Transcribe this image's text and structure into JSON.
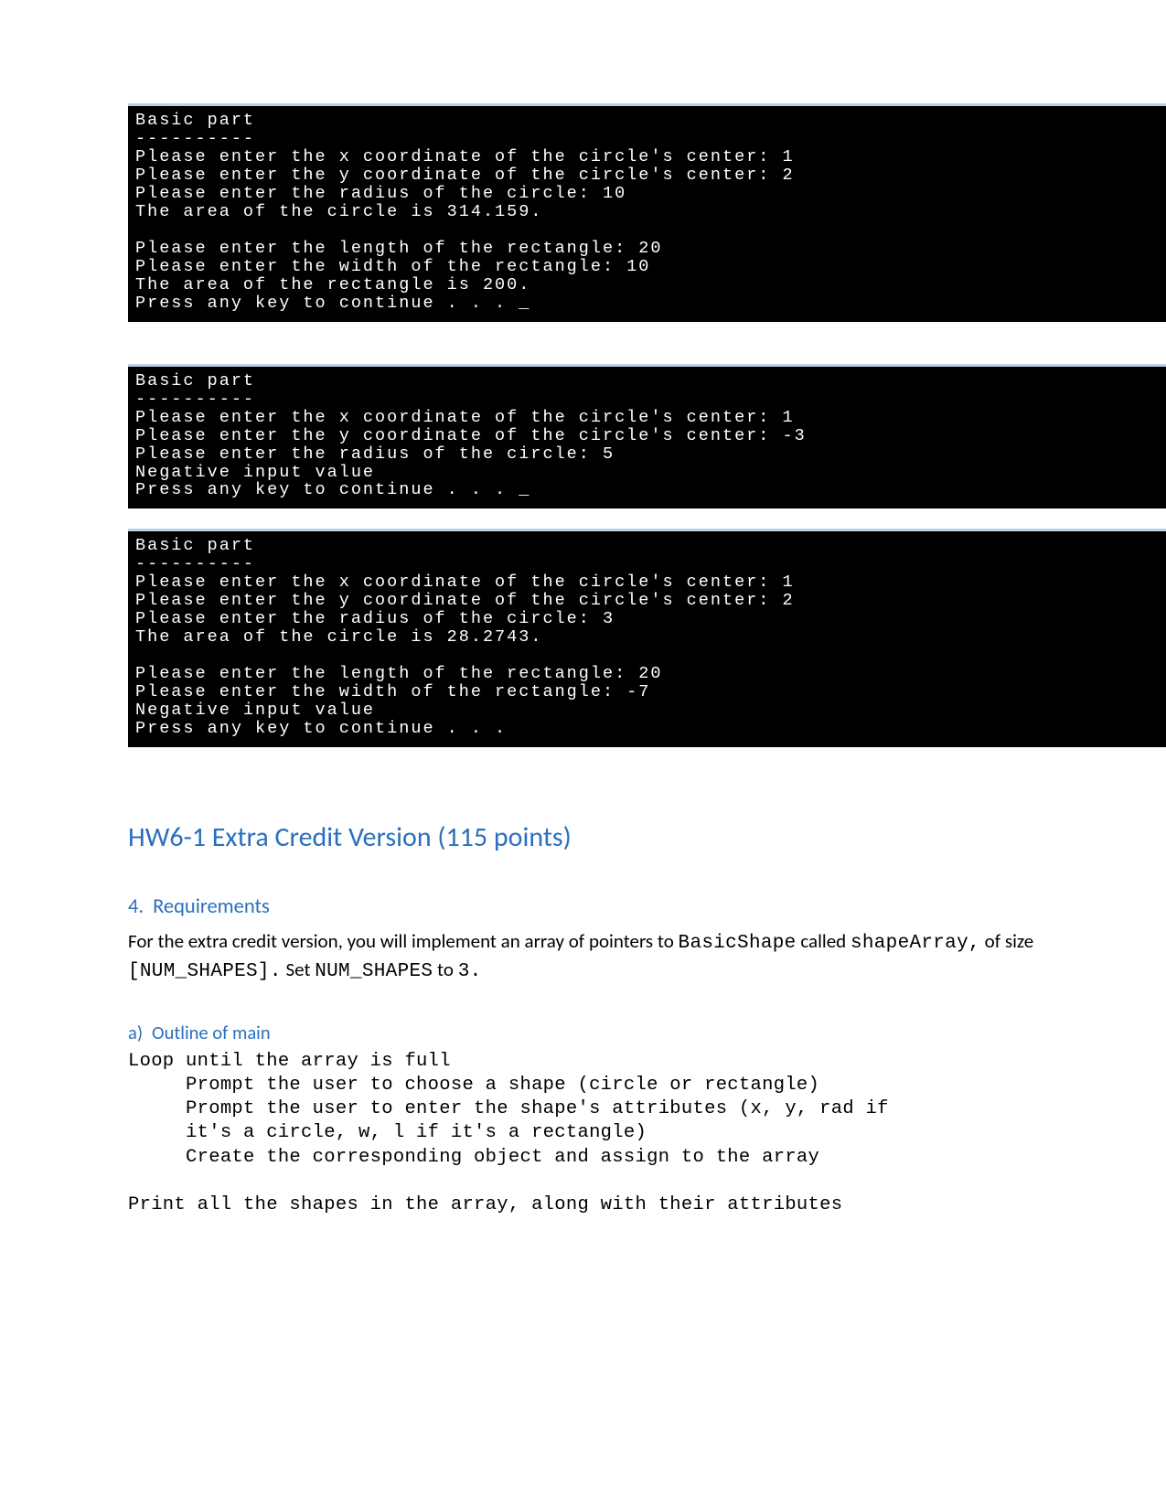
{
  "terminals": [
    {
      "text": "Basic part\n----------\nPlease enter the x coordinate of the circle's center: 1\nPlease enter the y coordinate of the circle's center: 2\nPlease enter the radius of the circle: 10\nThe area of the circle is 314.159.\n\nPlease enter the length of the rectangle: 20\nPlease enter the width of the rectangle: 10\nThe area of the rectangle is 200.\nPress any key to continue . . . _"
    },
    {
      "text": "Basic part\n----------\nPlease enter the x coordinate of the circle's center: 1\nPlease enter the y coordinate of the circle's center: -3\nPlease enter the radius of the circle: 5\nNegative input value\nPress any key to continue . . . _"
    },
    {
      "text": "Basic part\n----------\nPlease enter the x coordinate of the circle's center: 1\nPlease enter the y coordinate of the circle's center: 2\nPlease enter the radius of the circle: 3\nThe area of the circle is 28.2743.\n\nPlease enter the length of the rectangle: 20\nPlease enter the width of the rectangle: -7\nNegative input value\nPress any key to continue . . ."
    }
  ],
  "heading1": "HW6-1 Extra Credit Version (115 points)",
  "section4": {
    "num": "4.",
    "title": "Requirements",
    "para": {
      "t0": "For the extra credit version, you will implement an array of pointers to ",
      "c0": "BasicShape",
      "t1": " called ",
      "c1": "shapeArray,",
      "t2": " of size ",
      "c2": "[NUM_SHAPES].",
      "t3": "  Set ",
      "c3": "NUM_SHAPES",
      "t4": " to ",
      "c4": "3."
    },
    "sub_a": {
      "al": "a)",
      "title": "Outline of main",
      "code": "Loop until the array is full\n     Prompt the user to choose a shape (circle or rectangle)\n     Prompt the user to enter the shape's attributes (x, y, rad if\n     it's a circle, w, l if it's a rectangle)\n     Create the corresponding object and assign to the array\n\nPrint all the shapes in the array, along with their attributes"
    }
  }
}
